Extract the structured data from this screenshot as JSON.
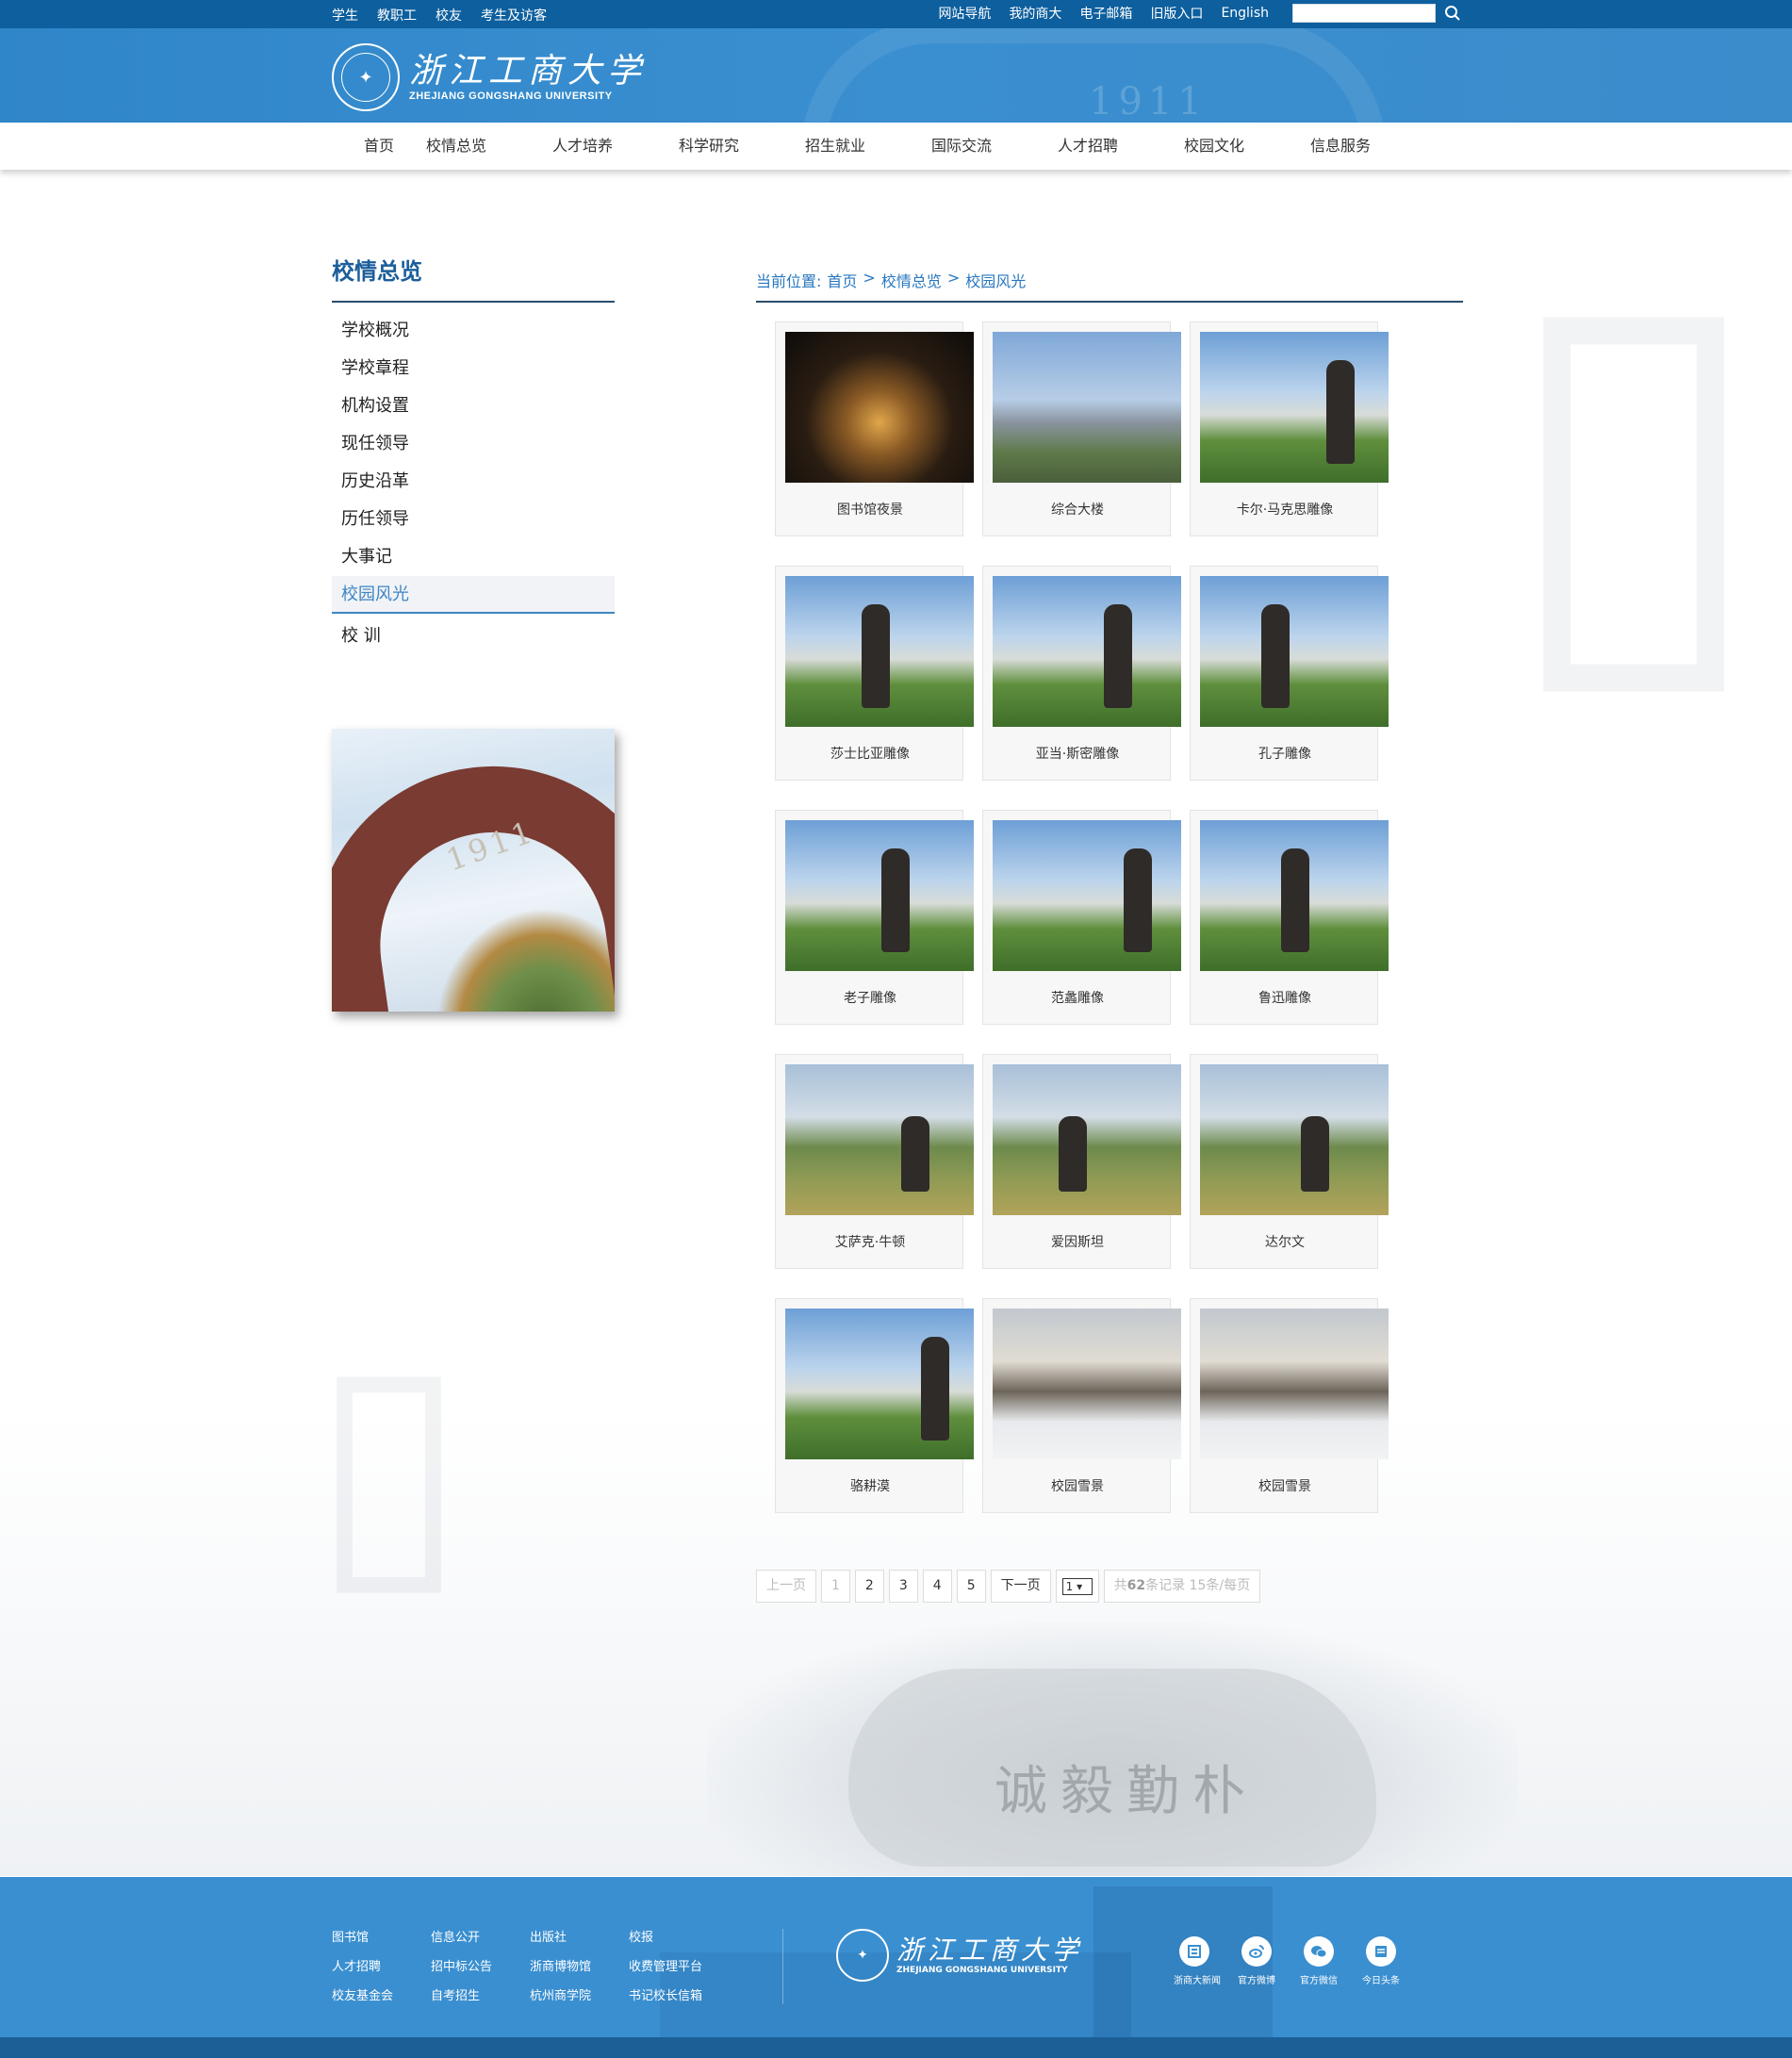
{
  "topbar": {
    "left_links": [
      "学生",
      "教职工",
      "校友",
      "考生及访客"
    ],
    "right_links": [
      "网站导航",
      "我的商大",
      "电子邮箱",
      "旧版入口",
      "English"
    ],
    "search_placeholder": ""
  },
  "header": {
    "logo_cn": "浙江工商大学",
    "logo_en": "ZHEJIANG GONGSHANG UNIVERSITY",
    "gate_year": "1911"
  },
  "nav": [
    "首页",
    "校情总览",
    "人才培养",
    "科学研究",
    "招生就业",
    "国际交流",
    "人才招聘",
    "校园文化",
    "信息服务"
  ],
  "sidebar": {
    "title": "校情总览",
    "items": [
      "学校概况",
      "学校章程",
      "机构设置",
      "现任领导",
      "历史沿革",
      "历任领导",
      "大事记",
      "校园风光",
      "校 训"
    ],
    "active_index": 7,
    "photo_year": "1911"
  },
  "breadcrumb": {
    "prefix": "当前位置:",
    "items": [
      "首页",
      "校情总览",
      "校园风光"
    ],
    "separator": ">"
  },
  "gallery": [
    {
      "caption": "图书馆夜景",
      "scene": "night"
    },
    {
      "caption": "综合大楼",
      "scene": "tower"
    },
    {
      "caption": "卡尔·马克思雕像",
      "scene": "statue"
    },
    {
      "caption": "莎士比亚雕像",
      "scene": "statue"
    },
    {
      "caption": "亚当·斯密雕像",
      "scene": "statue"
    },
    {
      "caption": "孔子雕像",
      "scene": "statue"
    },
    {
      "caption": "老子雕像",
      "scene": "statue"
    },
    {
      "caption": "范蠡雕像",
      "scene": "statue"
    },
    {
      "caption": "鲁迅雕像",
      "scene": "statue"
    },
    {
      "caption": "艾萨克·牛顿",
      "scene": "field"
    },
    {
      "caption": "爱因斯坦",
      "scene": "field"
    },
    {
      "caption": "达尔文",
      "scene": "field"
    },
    {
      "caption": "骆耕漠",
      "scene": "statue"
    },
    {
      "caption": "校园雪景",
      "scene": "snow"
    },
    {
      "caption": "校园雪景",
      "scene": "snow"
    }
  ],
  "pagination": {
    "prev": "上一页",
    "pages": [
      "1",
      "2",
      "3",
      "4",
      "5"
    ],
    "current": "1",
    "next": "下一页",
    "select_value": "1",
    "info_prefix": "共",
    "info_total": "62",
    "info_suffix": "条记录 15条/每页"
  },
  "decor": {
    "stone_text": "诚毅勤朴"
  },
  "footer": {
    "links": [
      "图书馆",
      "信息公开",
      "出版社",
      "校报",
      "人才招聘",
      "招中标公告",
      "浙商博物馆",
      "收费管理平台",
      "校友基金会",
      "自考招生",
      "杭州商学院",
      "书记校长信箱"
    ],
    "logo_cn": "浙江工商大学",
    "logo_en": "ZHEJIANG GONGSHANG UNIVERSITY",
    "social": [
      {
        "label": "浙商大新闻",
        "icon": "news-icon"
      },
      {
        "label": "官方微博",
        "icon": "weibo-icon"
      },
      {
        "label": "官方微信",
        "icon": "wechat-icon"
      },
      {
        "label": "今日头条",
        "icon": "toutiao-icon"
      }
    ]
  },
  "colors": {
    "topbar": "#0d5f9e",
    "header": "#3a8fd0",
    "accent": "#1b5e9b",
    "active": "#3e86c4"
  }
}
